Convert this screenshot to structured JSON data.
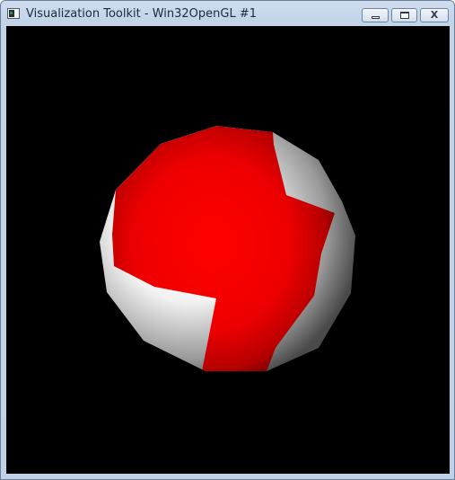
{
  "window": {
    "title": "Visualization Toolkit - Win32OpenGL #1",
    "icon": "vtk-app-icon"
  },
  "controls": {
    "minimize": "minimize-icon",
    "maximize": "maximize-icon",
    "close_label": "X"
  },
  "render_view": {
    "background": "#000000",
    "object": "sphere",
    "colors": {
      "primary_patch": "#ff0000",
      "secondary_patch": "#ffffff"
    }
  }
}
